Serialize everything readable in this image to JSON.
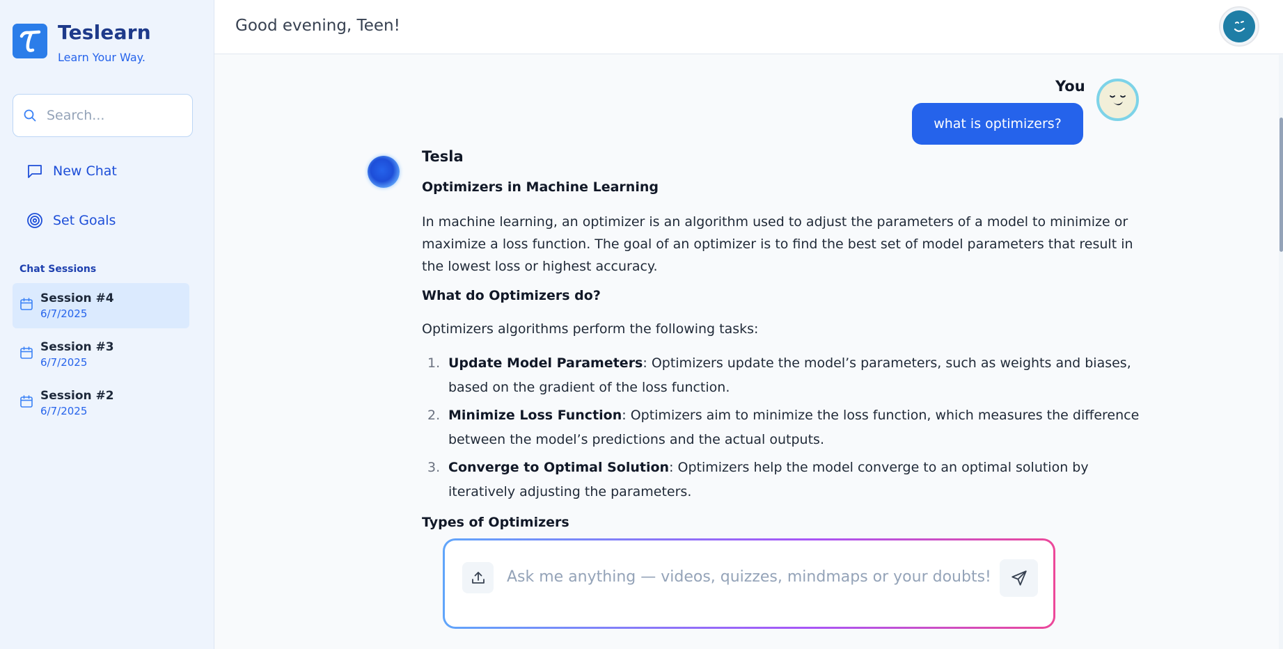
{
  "brand": {
    "name": "Teslearn",
    "tagline": "Learn Your Way.",
    "logo_glyph": "τ",
    "accent": "#2b7de9"
  },
  "search": {
    "placeholder": "Search..."
  },
  "nav": [
    {
      "label": "New Chat",
      "icon": "chat-bubble-icon"
    },
    {
      "label": "Set Goals",
      "icon": "target-icon"
    }
  ],
  "sessions": {
    "title": "Chat Sessions",
    "items": [
      {
        "title": "Session #4",
        "date": "6/7/2025",
        "active": true
      },
      {
        "title": "Session #3",
        "date": "6/7/2025",
        "active": false
      },
      {
        "title": "Session #2",
        "date": "6/7/2025",
        "active": false
      }
    ]
  },
  "header": {
    "greeting": "Good evening, Teen!"
  },
  "chat": {
    "user": {
      "name": "You",
      "message": "what is optimizers?"
    },
    "bot": {
      "name": "Tesla"
    },
    "answer": {
      "heading": "Optimizers in Machine Learning",
      "intro": "In machine learning, an optimizer is an algorithm used to adjust the parameters of a model to minimize or maximize a loss function. The goal of an optimizer is to find the best set of model parameters that result in the lowest loss or highest accuracy.",
      "subheading": "What do Optimizers do?",
      "lead": "Optimizers algorithms perform the following tasks:",
      "tasks": [
        {
          "num": "1.",
          "title": "Update Model Parameters",
          "text": ": Optimizers update the model’s parameters, such as weights and biases, based on the gradient of the loss function."
        },
        {
          "num": "2.",
          "title": "Minimize Loss Function",
          "text": ": Optimizers aim to minimize the loss function, which measures the difference between the model’s predictions and the actual outputs."
        },
        {
          "num": "3.",
          "title": "Converge to Optimal Solution",
          "text": ": Optimizers help the model converge to an optimal solution by iteratively adjusting the parameters."
        }
      ],
      "next_heading": "Types of Optimizers"
    }
  },
  "composer": {
    "placeholder": "Ask me anything — videos, quizzes, mindmaps or your doubts!",
    "upload_icon": "upload-icon",
    "send_icon": "send-icon"
  }
}
